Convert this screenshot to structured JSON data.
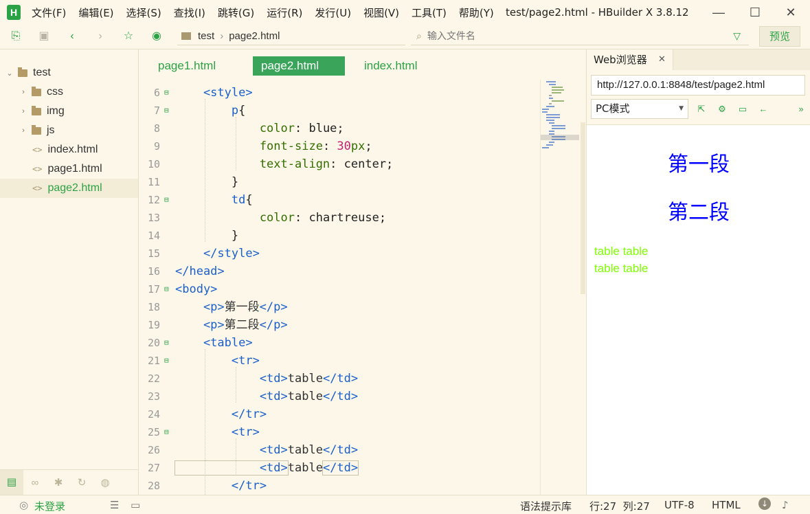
{
  "window": {
    "title": "test/page2.html - HBuilder X 3.8.12",
    "logo": "H"
  },
  "menu": [
    "文件(F)",
    "编辑(E)",
    "选择(S)",
    "查找(I)",
    "跳转(G)",
    "运行(R)",
    "发行(U)",
    "视图(V)",
    "工具(T)",
    "帮助(Y)"
  ],
  "toolbar": {
    "breadcrumb": [
      "test",
      "page2.html"
    ],
    "file_search_placeholder": "输入文件名",
    "preview_label": "预览"
  },
  "sidebar": {
    "project": "test",
    "items": [
      {
        "label": "css",
        "type": "folder"
      },
      {
        "label": "img",
        "type": "folder"
      },
      {
        "label": "js",
        "type": "folder"
      },
      {
        "label": "index.html",
        "type": "file"
      },
      {
        "label": "page1.html",
        "type": "file"
      },
      {
        "label": "page2.html",
        "type": "file",
        "active": true
      }
    ]
  },
  "tabs": [
    {
      "label": "page1.html"
    },
    {
      "label": "page2.html",
      "active": true
    },
    {
      "label": "index.html"
    }
  ],
  "editor": {
    "lines": [
      {
        "n": "6",
        "fold": true,
        "tokens": [
          [
            "tag",
            "    <style>"
          ]
        ]
      },
      {
        "n": "7",
        "fold": true,
        "tokens": [
          [
            "tag",
            "        p"
          ],
          [
            "val",
            "{"
          ]
        ]
      },
      {
        "n": "8",
        "tokens": [
          [
            "prop",
            "            color"
          ],
          [
            "val",
            ": blue;"
          ]
        ]
      },
      {
        "n": "9",
        "tokens": [
          [
            "prop",
            "            font-size"
          ],
          [
            "val",
            ": "
          ],
          [
            "num",
            "30"
          ],
          [
            "prop",
            "px"
          ],
          [
            "val",
            ";"
          ]
        ]
      },
      {
        "n": "10",
        "tokens": [
          [
            "prop",
            "            text-align"
          ],
          [
            "val",
            ": center;"
          ]
        ]
      },
      {
        "n": "11",
        "tokens": [
          [
            "val",
            "        }"
          ]
        ]
      },
      {
        "n": "12",
        "fold": true,
        "tokens": [
          [
            "tag",
            "        td"
          ],
          [
            "val",
            "{"
          ]
        ]
      },
      {
        "n": "13",
        "tokens": [
          [
            "prop",
            "            color"
          ],
          [
            "val",
            ": chartreuse;"
          ]
        ]
      },
      {
        "n": "14",
        "tokens": [
          [
            "val",
            "        }"
          ]
        ]
      },
      {
        "n": "15",
        "tokens": [
          [
            "tag",
            "    </style>"
          ]
        ]
      },
      {
        "n": "16",
        "tokens": [
          [
            "tag",
            "</head>"
          ]
        ]
      },
      {
        "n": "17",
        "fold": true,
        "tokens": [
          [
            "tag",
            "<body>"
          ]
        ]
      },
      {
        "n": "18",
        "tokens": [
          [
            "tag",
            "    <p>"
          ],
          [
            "txt",
            "第一段"
          ],
          [
            "tag",
            "</p>"
          ]
        ]
      },
      {
        "n": "19",
        "tokens": [
          [
            "tag",
            "    <p>"
          ],
          [
            "txt",
            "第二段"
          ],
          [
            "tag",
            "</p>"
          ]
        ]
      },
      {
        "n": "20",
        "fold": true,
        "tokens": [
          [
            "tag",
            "    <table>"
          ]
        ]
      },
      {
        "n": "21",
        "fold": true,
        "tokens": [
          [
            "tag",
            "        <tr>"
          ]
        ]
      },
      {
        "n": "22",
        "tokens": [
          [
            "tag",
            "            <td>"
          ],
          [
            "txt",
            "table"
          ],
          [
            "tag",
            "</td>"
          ]
        ]
      },
      {
        "n": "23",
        "tokens": [
          [
            "tag",
            "            <td>"
          ],
          [
            "txt",
            "table"
          ],
          [
            "tag",
            "</td>"
          ]
        ]
      },
      {
        "n": "24",
        "tokens": [
          [
            "tag",
            "        </tr>"
          ]
        ]
      },
      {
        "n": "25",
        "fold": true,
        "tokens": [
          [
            "tag",
            "        <tr>"
          ]
        ]
      },
      {
        "n": "26",
        "tokens": [
          [
            "tag",
            "            <td>"
          ],
          [
            "txt",
            "table"
          ],
          [
            "tag",
            "</td>"
          ]
        ]
      },
      {
        "n": "27",
        "tokens": [
          [
            "tag",
            "            <td>"
          ],
          [
            "txt",
            "table"
          ],
          [
            "tag",
            "</td>"
          ]
        ],
        "boxed": true
      },
      {
        "n": "28",
        "tokens": [
          [
            "tag",
            "        </tr>"
          ]
        ]
      }
    ]
  },
  "browser": {
    "tab_label": "Web浏览器",
    "url": "http://127.0.0.1:8848/test/page2.html",
    "mode": "PC模式",
    "page": {
      "paragraphs": [
        "第一段",
        "第二段"
      ],
      "table_rows": [
        "table table",
        "table table"
      ],
      "paragraph_color": "#0000ff",
      "td_color": "#7fff00"
    }
  },
  "statusbar": {
    "login": "未登录",
    "hint_lib": "语法提示库",
    "position": "行:27  列:27",
    "encoding": "UTF-8",
    "language": "HTML"
  },
  "colors": {
    "accent": "#2ba245",
    "background": "#fcf7e8"
  }
}
